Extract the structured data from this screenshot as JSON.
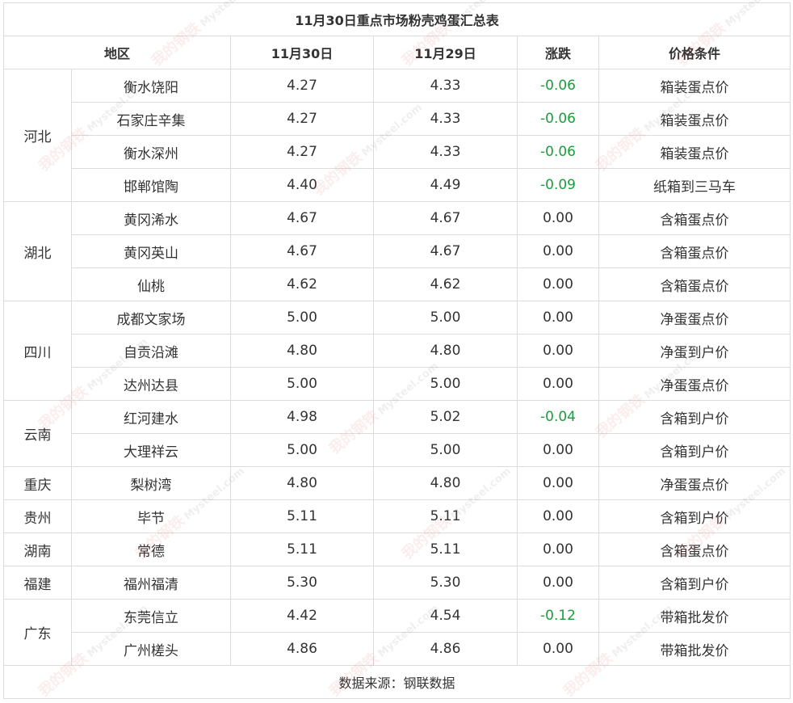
{
  "table": {
    "title": "11月30日重点市场粉壳鸡蛋汇总表",
    "headers": [
      "地区",
      "11月30日",
      "11月29日",
      "涨跌",
      "价格条件"
    ],
    "groups": [
      {
        "region": "河北",
        "rows": [
          {
            "market": "衡水饶阳",
            "d30": "4.27",
            "d29": "4.33",
            "change": "-0.06",
            "condition": "箱装蛋点价"
          },
          {
            "market": "石家庄辛集",
            "d30": "4.27",
            "d29": "4.33",
            "change": "-0.06",
            "condition": "箱装蛋点价"
          },
          {
            "market": "衡水深州",
            "d30": "4.27",
            "d29": "4.33",
            "change": "-0.06",
            "condition": "箱装蛋点价"
          },
          {
            "market": "邯郸馆陶",
            "d30": "4.40",
            "d29": "4.49",
            "change": "-0.09",
            "condition": "纸箱到三马车"
          }
        ]
      },
      {
        "region": "湖北",
        "rows": [
          {
            "market": "黄冈浠水",
            "d30": "4.67",
            "d29": "4.67",
            "change": "0.00",
            "condition": "含箱蛋点价"
          },
          {
            "market": "黄冈英山",
            "d30": "4.67",
            "d29": "4.67",
            "change": "0.00",
            "condition": "含箱蛋点价"
          },
          {
            "market": "仙桃",
            "d30": "4.62",
            "d29": "4.62",
            "change": "0.00",
            "condition": "含箱蛋点价"
          }
        ]
      },
      {
        "region": "四川",
        "rows": [
          {
            "market": "成都文家场",
            "d30": "5.00",
            "d29": "5.00",
            "change": "0.00",
            "condition": "净蛋蛋点价"
          },
          {
            "market": "自贡沿滩",
            "d30": "4.80",
            "d29": "4.80",
            "change": "0.00",
            "condition": "净蛋到户价"
          },
          {
            "market": "达州达县",
            "d30": "5.00",
            "d29": "5.00",
            "change": "0.00",
            "condition": "净蛋蛋点价"
          }
        ]
      },
      {
        "region": "云南",
        "rows": [
          {
            "market": "红河建水",
            "d30": "4.98",
            "d29": "5.02",
            "change": "-0.04",
            "condition": "含箱到户价"
          },
          {
            "market": "大理祥云",
            "d30": "5.00",
            "d29": "5.00",
            "change": "0.00",
            "condition": "含箱到户价"
          }
        ]
      },
      {
        "region": "重庆",
        "rows": [
          {
            "market": "梨树湾",
            "d30": "4.80",
            "d29": "4.80",
            "change": "0.00",
            "condition": "净蛋蛋点价"
          }
        ]
      },
      {
        "region": "贵州",
        "rows": [
          {
            "market": "毕节",
            "d30": "5.11",
            "d29": "5.11",
            "change": "0.00",
            "condition": "含箱到户价"
          }
        ]
      },
      {
        "region": "湖南",
        "rows": [
          {
            "market": "常德",
            "d30": "5.11",
            "d29": "5.11",
            "change": "0.00",
            "condition": "含箱蛋点价"
          }
        ]
      },
      {
        "region": "福建",
        "rows": [
          {
            "market": "福州福清",
            "d30": "5.30",
            "d29": "5.30",
            "change": "0.00",
            "condition": "含箱到户价"
          }
        ]
      },
      {
        "region": "广东",
        "rows": [
          {
            "market": "东莞信立",
            "d30": "4.42",
            "d29": "4.54",
            "change": "-0.12",
            "condition": "带箱批发价"
          },
          {
            "market": "广州槎头",
            "d30": "4.86",
            "d29": "4.86",
            "change": "0.00",
            "condition": "带箱批发价"
          }
        ]
      }
    ],
    "footer": "数据来源：钢联数据"
  },
  "colors": {
    "negative": "#1a9e3c",
    "border": "#dcdcdc",
    "text": "#333333"
  },
  "watermark": {
    "logo_text": "我的钢铁",
    "brand": "Mysteel.com"
  }
}
